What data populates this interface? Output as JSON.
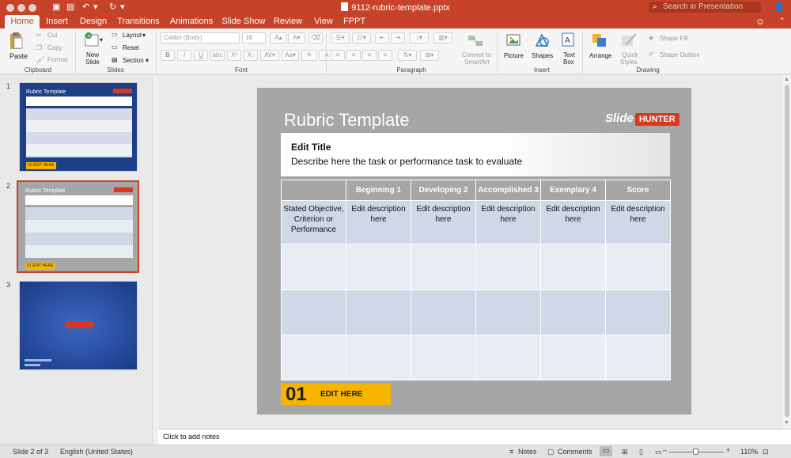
{
  "window": {
    "title": "9112-rubric-template.pptx",
    "search_placeholder": "Search in Presentation"
  },
  "tabs": [
    "Home",
    "Insert",
    "Design",
    "Transitions",
    "Animations",
    "Slide Show",
    "Review",
    "View",
    "FPPT"
  ],
  "active_tab": "Home",
  "ribbon": {
    "clipboard": {
      "paste": "Paste",
      "cut": "Cut",
      "copy": "Copy",
      "format": "Format",
      "group": "Clipboard"
    },
    "slides": {
      "new_slide_1": "New",
      "new_slide_2": "Slide",
      "layout": "Layout",
      "reset": "Reset",
      "section": "Section",
      "group": "Slides"
    },
    "font": {
      "font_name": "Calibri (Body)",
      "font_size": "16",
      "group": "Font"
    },
    "paragraph": {
      "group": "Paragraph",
      "convert_1": "Convert to",
      "convert_2": "SmartArt"
    },
    "insert": {
      "picture": "Picture",
      "shapes": "Shapes",
      "textbox_1": "Text",
      "textbox_2": "Box",
      "group": "Insert"
    },
    "drawing": {
      "arrange": "Arrange",
      "quick_styles_1": "Quick",
      "quick_styles_2": "Styles",
      "shape_fill": "Shape Fill",
      "shape_outline": "Shape Outline",
      "group": "Drawing"
    }
  },
  "thumbnails": [
    {
      "num": "1",
      "title": "Rubric Template",
      "footer_num": "01",
      "footer": "EDIT HERE"
    },
    {
      "num": "2",
      "title": "Rubric Template",
      "footer_num": "01",
      "footer": "EDIT HERE"
    },
    {
      "num": "3"
    }
  ],
  "slide": {
    "title": "Rubric Template",
    "logo_slide": "Slide",
    "logo_hunter": "HUNTER",
    "header_title": "Edit Title",
    "header_desc": "Describe here the task or performance task to evaluate",
    "columns": [
      "",
      "Beginning 1",
      "Developing 2",
      "Accomplished 3",
      "Exemplary 4",
      "Score"
    ],
    "row1": [
      "Stated Objective, Criterion or Performance",
      "Edit description here",
      "Edit description here",
      "Edit description here",
      "Edit description here",
      "Edit description here"
    ],
    "footer_num": "01",
    "footer_label": "EDIT HERE"
  },
  "notes_placeholder": "Click to add notes",
  "status": {
    "slide_info": "Slide 2 of 3",
    "language": "English (United States)",
    "notes": "Notes",
    "comments": "Comments",
    "zoom": "110%"
  }
}
